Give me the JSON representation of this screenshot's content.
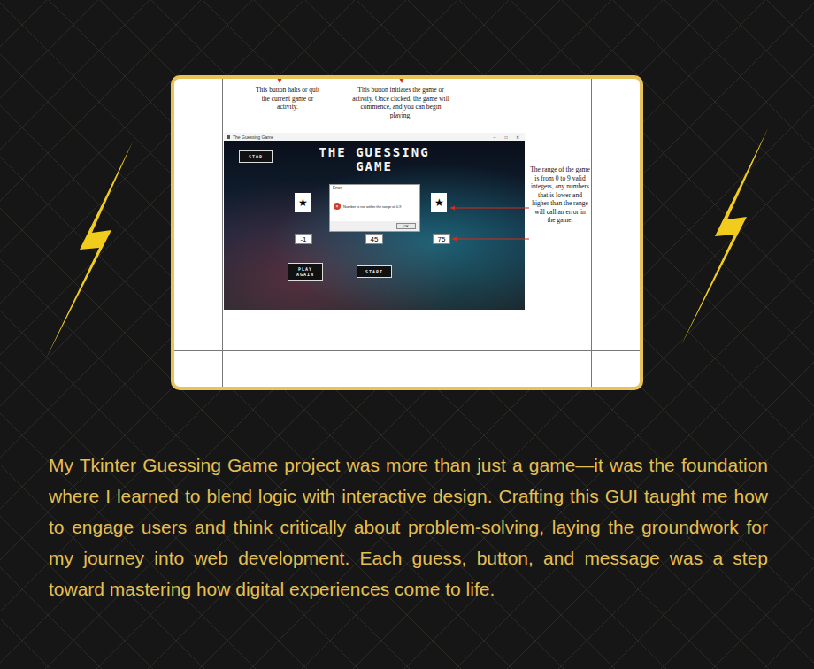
{
  "document": {
    "annotations_top": [
      {
        "text": "This button halts or quit the current game or activity."
      },
      {
        "text": "This button initiates the game or activity. Once clicked, the game will commence, and you can begin playing."
      }
    ],
    "annotation_right": "The range of the game is from 0 to 9 valid integers, any numbers that is lower and higher than the range will call an error in the game.",
    "game_window": {
      "title": "The Guessing Game",
      "controls": [
        "–",
        "□",
        "✕"
      ],
      "heading": "THE GUESSING GAME",
      "buttons": [
        {
          "label": "STOP"
        },
        {
          "label": "PLAY AGAIN"
        },
        {
          "label": "START"
        }
      ],
      "stars": [
        "★",
        "★"
      ],
      "entries": [
        "-1",
        "45",
        "75"
      ],
      "dialog": {
        "title": "Error",
        "icon": "×",
        "message": "Number is not within the range of 0-9",
        "button": "OK"
      }
    }
  },
  "caption": "My Tkinter Guessing Game project was more than just a game—it was the foundation where I learned to blend logic with interactive design. Crafting this GUI taught me how to engage users and think critically about problem-solving, laying the groundwork for my journey into web development. Each guess, button, and message was a step toward mastering how digital experiences come to life."
}
